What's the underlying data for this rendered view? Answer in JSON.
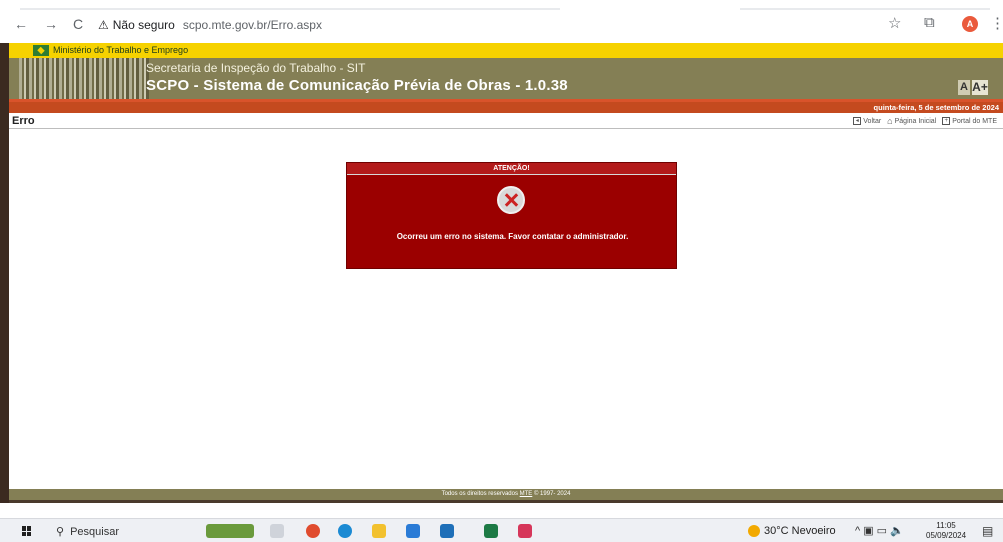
{
  "browser": {
    "back": "←",
    "forward": "→",
    "reload": "C",
    "security_warning_icon": "warning-triangle",
    "security_label": "Não seguro",
    "url": "scpo.mte.gov.br/Erro.aspx",
    "avatar_letter": "A"
  },
  "gov_bar": {
    "label": "Ministério do Trabalho e Emprego"
  },
  "header": {
    "subtitle": "Secretaria de Inspeção do Trabalho - SIT",
    "title": "SCPO - Sistema de Comunicação Prévia de Obras - 1.0.38",
    "font_decrease": "A",
    "font_increase": "A+"
  },
  "date_bar": {
    "text": "quinta-feira, 5 de setembro de 2024"
  },
  "page": {
    "title": "Erro",
    "links": {
      "back": "Voltar",
      "home": "Página Inicial",
      "portal": "Portal do MTE"
    }
  },
  "error": {
    "heading": "ATENÇÃO!",
    "message": "Ocorreu um erro no sistema. Favor contatar o administrador."
  },
  "footer": {
    "prefix": "Todos os direitos reservados",
    "link": "MTE",
    "suffix": "© 1997- 2024"
  },
  "taskbar": {
    "search_placeholder": "Pesquisar",
    "weather": "30°C  Nevoeiro",
    "time": "11:05",
    "date": "05/09/2024"
  },
  "colors": {
    "gov_yellow": "#f6d200",
    "banner_olive": "#847f55",
    "date_bar_orange": "#c44a1f",
    "error_red": "#9b0000"
  }
}
